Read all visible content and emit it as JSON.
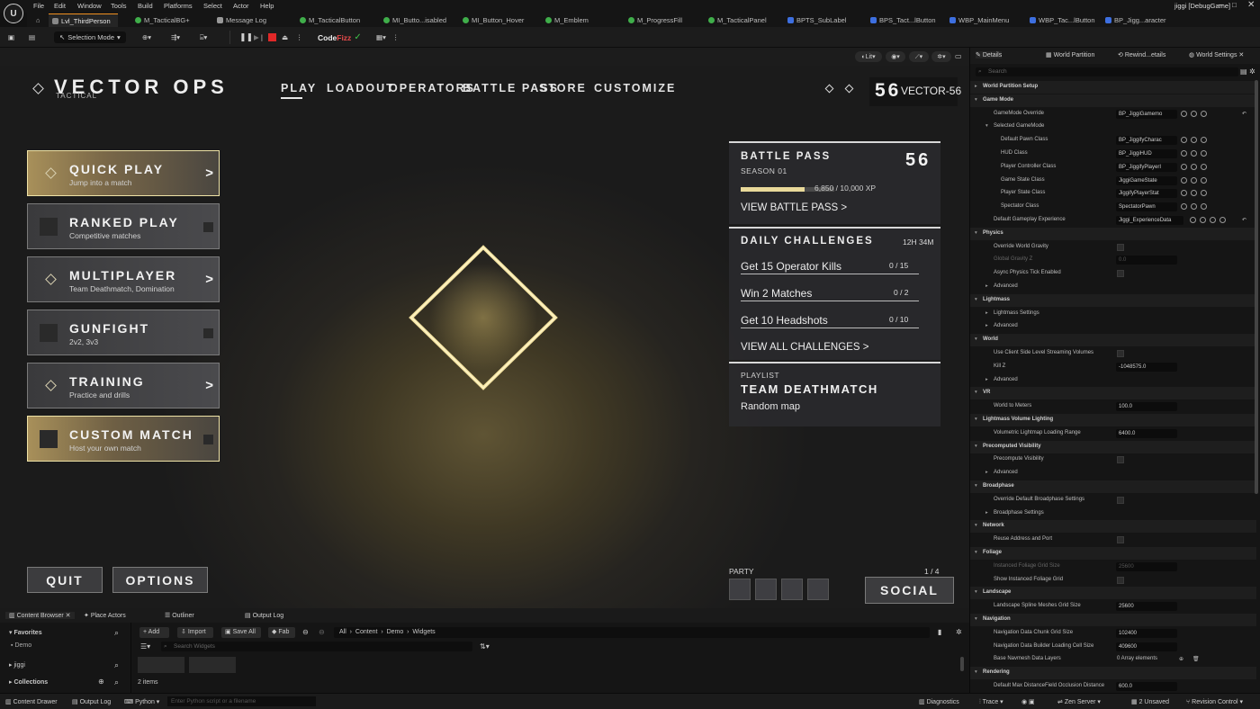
{
  "menu": {
    "items": [
      "File",
      "Edit",
      "Window",
      "Tools",
      "Build",
      "Select",
      "Actor",
      "Help"
    ],
    "platforms": "Platforms",
    "project": "jiggi [DebugGame]"
  },
  "tabs": [
    {
      "label": "Lvl_ThirdPerson",
      "color": "#e8e8e8"
    },
    {
      "label": "M_TacticalBG+",
      "color": "#3fae4a"
    },
    {
      "label": "Message Log",
      "color": "#bbbbbb"
    },
    {
      "label": "M_TacticalButton",
      "color": "#3fae4a"
    },
    {
      "label": "MI_Butto...isabled",
      "color": "#3fae4a"
    },
    {
      "label": "MI_Button_Hover",
      "color": "#3fae4a"
    },
    {
      "label": "M_Emblem",
      "color": "#3fae4a"
    },
    {
      "label": "M_ProgressFill",
      "color": "#3fae4a"
    },
    {
      "label": "M_TacticalPanel",
      "color": "#3fae4a"
    },
    {
      "label": "BPTS_SubLabel",
      "color": "#3d6fe0"
    },
    {
      "label": "BPS_Tact...lButton",
      "color": "#3d6fe0"
    },
    {
      "label": "WBP_MainMenu",
      "color": "#3d6fe0"
    },
    {
      "label": "WBP_Tac...lButton",
      "color": "#3d6fe0"
    },
    {
      "label": "BP_Jigg...aracter",
      "color": "#3d6fe0"
    }
  ],
  "toolbar": {
    "selection_mode": "Selection Mode",
    "codefizz_a": "Code",
    "codefizz_b": "Fizz"
  },
  "viewport": {
    "lit": "Lit"
  },
  "game": {
    "title": "VECTOR OPS",
    "subtitle": "TACTICAL",
    "nav": [
      "PLAY",
      "LOADOUT",
      "OPERATORS",
      "BATTLE PASS",
      "STORE",
      "CUSTOMIZE"
    ],
    "player_level": "56",
    "player_name": "VECTOR-56",
    "menu_buttons": [
      {
        "label": "QUICK PLAY",
        "sub": "Jump into a match"
      },
      {
        "label": "RANKED PLAY",
        "sub": "Competitive matches"
      },
      {
        "label": "MULTIPLAYER",
        "sub": "Team Deathmatch, Domination"
      },
      {
        "label": "GUNFIGHT",
        "sub": "2v2, 3v3"
      },
      {
        "label": "TRAINING",
        "sub": "Practice and drills"
      },
      {
        "label": "CUSTOM MATCH",
        "sub": "Host your own match"
      }
    ],
    "arrow": ">",
    "quit": "QUIT",
    "options": "OPTIONS",
    "battle_pass": {
      "title": "BATTLE PASS",
      "season": "SEASON 01",
      "level": "56",
      "xp_current": "6,850",
      "xp_total": "/ 10,000 XP",
      "progress": 0.685,
      "view": "VIEW BATTLE PASS  >"
    },
    "daily": {
      "title": "DAILY CHALLENGES",
      "timer": "12H 34M",
      "items": [
        {
          "name": "Get 15 Operator Kills",
          "count": "0 / 15"
        },
        {
          "name": "Win 2 Matches",
          "count": "0 / 2"
        },
        {
          "name": "Get 10 Headshots",
          "count": "0 / 10"
        }
      ],
      "view": "VIEW ALL CHALLENGES  >"
    },
    "playlist": {
      "label": "PLAYLIST",
      "mode": "TEAM DEATHMATCH",
      "map": "Random map"
    },
    "party": {
      "label": "PARTY",
      "count": "1 / 4"
    },
    "social": "SOCIAL"
  },
  "details": {
    "tabs": [
      "Details",
      "World Partition",
      "Rewind...etails",
      "World Settings"
    ],
    "search_placeholder": "Search",
    "rows": [
      {
        "t": "cat",
        "l": "World Partition Setup",
        "c": "▸"
      },
      {
        "t": "cat",
        "l": "Game Mode",
        "c": "▾"
      },
      {
        "t": "val",
        "l": "GameMode Override",
        "v": "BP_JiggiGamemo",
        "d": 12,
        "ic": 3
      },
      {
        "t": "lbl",
        "l": "Selected GameMode",
        "d": 12,
        "c": "▾"
      },
      {
        "t": "val",
        "l": "Default Pawn Class",
        "v": "BP_JiggifyCharac",
        "d": 20,
        "ic": 3
      },
      {
        "t": "val",
        "l": "HUD Class",
        "v": "BP_JiggiHUD",
        "d": 20,
        "ic": 3
      },
      {
        "t": "val",
        "l": "Player Controller Class",
        "v": "BP_JiggifyPlayerI",
        "d": 20,
        "ic": 3
      },
      {
        "t": "val",
        "l": "Game State Class",
        "v": "JiggiGameState",
        "d": 20,
        "ic": 3
      },
      {
        "t": "val",
        "l": "Player State Class",
        "v": "JiggifyPlayerStat",
        "d": 20,
        "ic": 3
      },
      {
        "t": "val",
        "l": "Spectator Class",
        "v": "SpectatorPawn",
        "d": 20,
        "ic": 3
      },
      {
        "t": "val",
        "l": "Default Gameplay Experience",
        "v": "Jiggi_ExperienceData",
        "d": 12,
        "ic": 4,
        "wide": true
      },
      {
        "t": "cat",
        "l": "Physics",
        "c": "▾"
      },
      {
        "t": "chk",
        "l": "Override World Gravity",
        "d": 12
      },
      {
        "t": "val",
        "l": "Global Gravity Z",
        "v": "0.0",
        "d": 12,
        "dis": true
      },
      {
        "t": "chk",
        "l": "Async Physics Tick Enabled",
        "d": 12
      },
      {
        "t": "lbl",
        "l": "Advanced",
        "d": 12,
        "c": "▸"
      },
      {
        "t": "cat",
        "l": "Lightmass",
        "c": "▾"
      },
      {
        "t": "lbl",
        "l": "Lightmass Settings",
        "d": 12,
        "c": "▸"
      },
      {
        "t": "lbl",
        "l": "Advanced",
        "d": 12,
        "c": "▸"
      },
      {
        "t": "cat",
        "l": "World",
        "c": "▾"
      },
      {
        "t": "chk",
        "l": "Use Client Side Level Streaming Volumes",
        "d": 12
      },
      {
        "t": "val",
        "l": "Kill Z",
        "v": "-1048575.0",
        "d": 12
      },
      {
        "t": "lbl",
        "l": "Advanced",
        "d": 12,
        "c": "▸"
      },
      {
        "t": "cat",
        "l": "VR",
        "c": "▾"
      },
      {
        "t": "val",
        "l": "World to Meters",
        "v": "100.0",
        "d": 12
      },
      {
        "t": "cat",
        "l": "Lightmass Volume Lighting",
        "c": "▾"
      },
      {
        "t": "val",
        "l": "Volumetric Lightmap Loading Range",
        "v": "6400.0",
        "d": 12
      },
      {
        "t": "cat",
        "l": "Precomputed Visibility",
        "c": "▾"
      },
      {
        "t": "chk",
        "l": "Precompute Visibility",
        "d": 12
      },
      {
        "t": "lbl",
        "l": "Advanced",
        "d": 12,
        "c": "▸"
      },
      {
        "t": "cat",
        "l": "Broadphase",
        "c": "▾"
      },
      {
        "t": "chk",
        "l": "Override Default Broadphase Settings",
        "d": 12
      },
      {
        "t": "lbl",
        "l": "Broadphase Settings",
        "d": 12,
        "c": "▸"
      },
      {
        "t": "cat",
        "l": "Network",
        "c": "▾"
      },
      {
        "t": "chk",
        "l": "Reuse Address and Port",
        "d": 12
      },
      {
        "t": "cat",
        "l": "Foliage",
        "c": "▾"
      },
      {
        "t": "val",
        "l": "Instanced Foliage Grid Size",
        "v": "25600",
        "d": 12,
        "dis": true
      },
      {
        "t": "chk",
        "l": "Show Instanced Foliage Grid",
        "d": 12
      },
      {
        "t": "cat",
        "l": "Landscape",
        "c": "▾"
      },
      {
        "t": "val",
        "l": "Landscape Spline Meshes Grid Size",
        "v": "25600",
        "d": 12
      },
      {
        "t": "cat",
        "l": "Navigation",
        "c": "▾"
      },
      {
        "t": "val",
        "l": "Navigation Data Chunk Grid Size",
        "v": "102400",
        "d": 12
      },
      {
        "t": "val",
        "l": "Navigation Data Builder Loading Cell Size",
        "v": "409600",
        "d": 12
      },
      {
        "t": "arr",
        "l": "Base Navmesh Data Layers",
        "v": "0 Array elements",
        "d": 12
      },
      {
        "t": "cat",
        "l": "Rendering",
        "c": "▾"
      },
      {
        "t": "val",
        "l": "Default Max DistanceField Occlusion Distance",
        "v": "600.0",
        "d": 12
      }
    ]
  },
  "bottom": {
    "tabs": [
      "Content Browser",
      "Place Actors",
      "Outliner",
      "Output Log"
    ],
    "favorites": "Favorites",
    "demo": "Demo",
    "jiggi": "jiggi",
    "collections": "Collections",
    "add": "+ Add",
    "import": "Import",
    "save_all": "Save All",
    "fab": "Fab",
    "path": [
      "All",
      "Content",
      "Demo",
      "Widgets"
    ],
    "search_placeholder": "Search Widgets",
    "items_count": "2 items"
  },
  "status": {
    "content_drawer": "Content Drawer",
    "output_log": "Output Log",
    "python": "Python",
    "cmd_placeholder": "Enter Python script or a filename",
    "diagnostics": "Diagnostics",
    "trace": "Trace",
    "zen": "Zen Server",
    "unsaved": "2 Unsaved",
    "revision": "Revision Control"
  }
}
